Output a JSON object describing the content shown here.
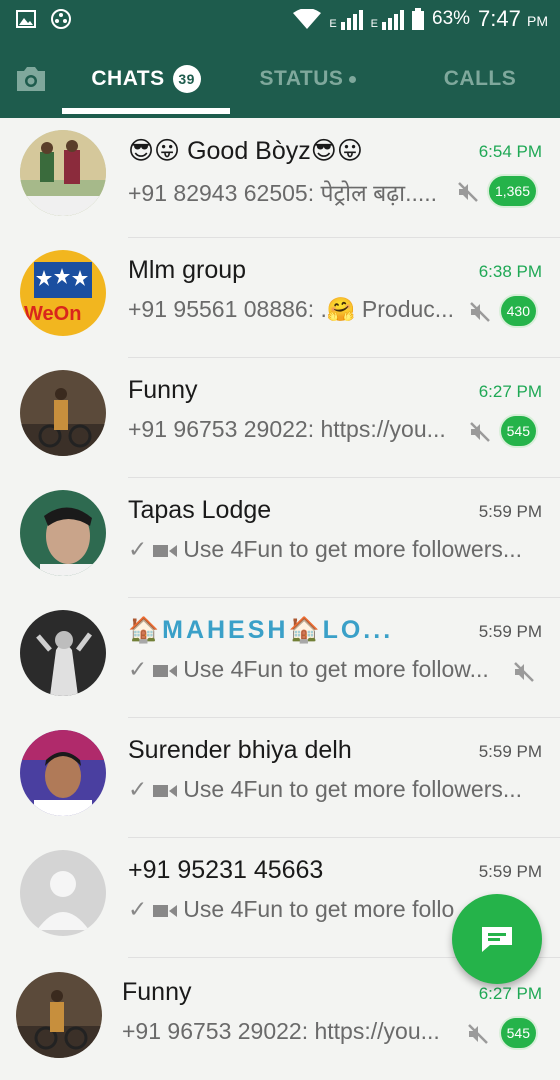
{
  "status_bar": {
    "battery": "63%",
    "time": "7:47",
    "time_suffix": "PM",
    "network_label_1": "E",
    "network_label_2": "E"
  },
  "tabs": {
    "chats": "CHATS",
    "chats_badge": "39",
    "status": "STATUS",
    "calls": "CALLS"
  },
  "chats": [
    {
      "name": "😎😛 Good Bòyz😎😛",
      "time": "6:54 PM",
      "preview": "+91 82943 62505: पेट्रोल बढ़ा.....",
      "unread": "1,365",
      "muted": true
    },
    {
      "name": "Mlm group",
      "time": "6:38 PM",
      "preview": "+91 95561 08886: .🤗 Produc...",
      "unread": "430",
      "muted": true,
      "avatar_text": "WeOn"
    },
    {
      "name": "Funny",
      "time": "6:27 PM",
      "preview": "+91 96753 29022: https://you...",
      "unread": "545",
      "muted": true
    },
    {
      "name": "Tapas Lodge",
      "time": "5:59 PM",
      "preview": "Use 4Fun to get more followers...",
      "muted": false
    },
    {
      "name": "🏠MAHESH🏠LO...",
      "time": "5:59 PM",
      "preview": "Use 4Fun to get more follow...",
      "muted": true
    },
    {
      "name": "Surender bhiya delh",
      "time": "5:59 PM",
      "preview": "Use 4Fun to get more followers...",
      "muted": false
    },
    {
      "name": "+91 95231 45663",
      "time": "5:59 PM",
      "preview": "Use 4Fun to get more follo",
      "muted": false
    },
    {
      "name": "Funny",
      "time": "6:27 PM",
      "preview": "+91 96753 29022: https://you...",
      "unread": "545",
      "muted": true
    }
  ],
  "colors": {
    "header": "#1e5c4d",
    "accent_green": "#25b34a",
    "time_green": "#1fa855"
  },
  "icons": [
    "gallery-icon",
    "notification-icon",
    "wifi-icon",
    "signal-icon",
    "battery-icon",
    "camera-icon",
    "mute-icon",
    "video-icon",
    "new-chat-icon"
  ]
}
